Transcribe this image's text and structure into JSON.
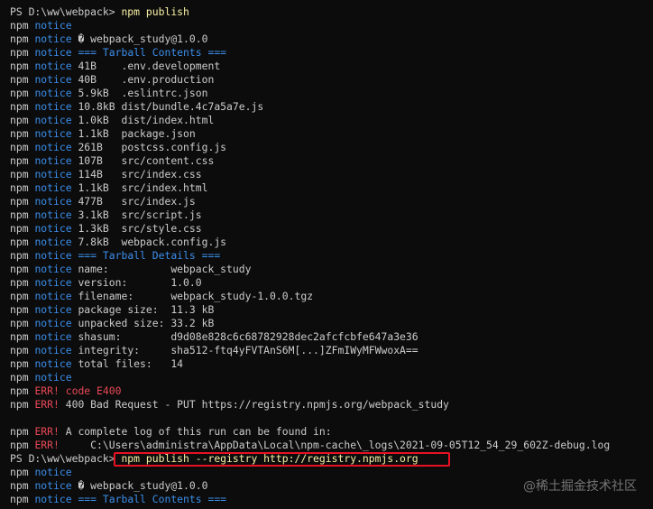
{
  "terminal": {
    "lines": [
      {
        "kind": "prompt",
        "prompt": "PS D:\\ww\\webpack> ",
        "command": "npm publish"
      },
      {
        "kind": "npm",
        "level": "notice",
        "text": ""
      },
      {
        "kind": "npm",
        "level": "notice",
        "text": "� webpack_study@1.0.0"
      },
      {
        "kind": "npm",
        "level": "notice",
        "text": "=== Tarball Contents ===",
        "header": true
      },
      {
        "kind": "npm",
        "level": "notice",
        "text": "41B    .env.development"
      },
      {
        "kind": "npm",
        "level": "notice",
        "text": "40B    .env.production"
      },
      {
        "kind": "npm",
        "level": "notice",
        "text": "5.9kB  .eslintrc.json"
      },
      {
        "kind": "npm",
        "level": "notice",
        "text": "10.8kB dist/bundle.4c7a5a7e.js"
      },
      {
        "kind": "npm",
        "level": "notice",
        "text": "1.0kB  dist/index.html"
      },
      {
        "kind": "npm",
        "level": "notice",
        "text": "1.1kB  package.json"
      },
      {
        "kind": "npm",
        "level": "notice",
        "text": "261B   postcss.config.js"
      },
      {
        "kind": "npm",
        "level": "notice",
        "text": "107B   src/content.css"
      },
      {
        "kind": "npm",
        "level": "notice",
        "text": "114B   src/index.css"
      },
      {
        "kind": "npm",
        "level": "notice",
        "text": "1.1kB  src/index.html"
      },
      {
        "kind": "npm",
        "level": "notice",
        "text": "477B   src/index.js"
      },
      {
        "kind": "npm",
        "level": "notice",
        "text": "3.1kB  src/script.js"
      },
      {
        "kind": "npm",
        "level": "notice",
        "text": "1.3kB  src/style.css"
      },
      {
        "kind": "npm",
        "level": "notice",
        "text": "7.8kB  webpack.config.js"
      },
      {
        "kind": "npm",
        "level": "notice",
        "text": "=== Tarball Details ===",
        "header": true
      },
      {
        "kind": "npm",
        "level": "notice",
        "text": "name:          webpack_study"
      },
      {
        "kind": "npm",
        "level": "notice",
        "text": "version:       1.0.0"
      },
      {
        "kind": "npm",
        "level": "notice",
        "text": "filename:      webpack_study-1.0.0.tgz"
      },
      {
        "kind": "npm",
        "level": "notice",
        "text": "package size:  11.3 kB"
      },
      {
        "kind": "npm",
        "level": "notice",
        "text": "unpacked size: 33.2 kB"
      },
      {
        "kind": "npm",
        "level": "notice",
        "text": "shasum:        d9d08e828c6c68782928dec2afcfcbfe647a3e36"
      },
      {
        "kind": "npm",
        "level": "notice",
        "text": "integrity:     sha512-ftq4yFVTAnS6M[...]ZFmIWyMFWwoxA=="
      },
      {
        "kind": "npm",
        "level": "notice",
        "text": "total files:   14"
      },
      {
        "kind": "npm",
        "level": "notice",
        "text": ""
      },
      {
        "kind": "npm",
        "level": "ERR!",
        "text": "code E400",
        "errhdr": true
      },
      {
        "kind": "npm",
        "level": "ERR!",
        "text": "400 Bad Request - PUT https://registry.npmjs.org/webpack_study"
      },
      {
        "kind": "blank"
      },
      {
        "kind": "npm",
        "level": "ERR!",
        "text": "A complete log of this run can be found in:"
      },
      {
        "kind": "npm",
        "level": "ERR!",
        "text": "    C:\\Users\\administra\\AppData\\Local\\npm-cache\\_logs\\2021-09-05T12_54_29_602Z-debug.log"
      },
      {
        "kind": "prompt",
        "prompt": "PS D:\\ww\\webpack> ",
        "command": "npm publish --registry http://registry.npmjs.org"
      },
      {
        "kind": "npm",
        "level": "notice",
        "text": ""
      },
      {
        "kind": "npm",
        "level": "notice",
        "text": "� webpack_study@1.0.0"
      },
      {
        "kind": "npm",
        "level": "notice",
        "text": "=== Tarball Contents ===",
        "header": true
      }
    ],
    "npm_word": "npm"
  },
  "watermark": "@稀土掘金技术社区",
  "colors": {
    "background": "#0c0c0c",
    "text": "#cccccc",
    "notice": "#3b8eea",
    "error": "#e74856",
    "command": "#f9f1a5",
    "highlight": "#e81123"
  }
}
